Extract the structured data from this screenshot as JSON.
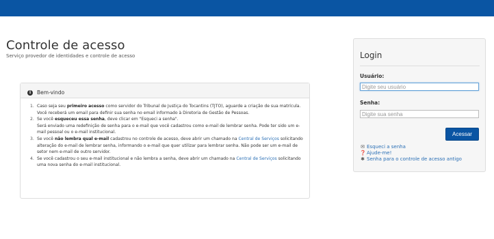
{
  "header": {
    "color": "#0a55a3"
  },
  "page": {
    "title": "Controle de acesso",
    "subtitle": "Serviço provedor de identidades e controle de acesso"
  },
  "welcome": {
    "icon": "info-icon",
    "title": "Bem-vindo",
    "items": [
      {
        "num": "1.",
        "pre": "Caso seja seu ",
        "bold": "primeiro acesso",
        "post": " como servidor do Tribunal de Justiça do Tocantins (TJTO), aguarde a criação de sua matrícula. Você receberá um email para definir sua senha no email informado à Diretoria de Gestão de Pessoas."
      },
      {
        "num": "2.",
        "pre": "Se você ",
        "bold": "esqueceu essa senha",
        "post": ", deve clicar em \"Esqueci a senha\".",
        "extra": "Será enviado uma redefinição de senha para o e-mail que você cadastrou como e-mail de lembrar senha. Pode ter sido um e-mail pessoal ou o e-mail institucional."
      },
      {
        "num": "3.",
        "pre": "Se você ",
        "bold": "não lembra qual e-mail",
        "mid": " cadastrou no controle de acesso, deve abrir um chamado na ",
        "link": "Central de Serviços",
        "post": " solicitando alteração do e-mail de lembrar senha, informando o e-mail que quer utilizar para lembrar senha. Não pode ser um e-mail de setor nem e-mail de outro servidor."
      },
      {
        "num": "4.",
        "pre": "Se você cadastrou o seu e-mail institucional e não lembra a senha, deve abrir um chamado na ",
        "link": "Central de Serviços",
        "post": " solicitando uma nova senha do e-mail institucional."
      }
    ]
  },
  "login": {
    "title": "Login",
    "username_label": "Usuário:",
    "username_placeholder": "Digite seu usuário",
    "password_label": "Senha:",
    "password_placeholder": "Digite sua senha",
    "submit_label": "Acessar",
    "links": [
      {
        "icon": "envelope-icon",
        "label": "Esqueci a senha"
      },
      {
        "icon": "question-icon",
        "label": "Ajude-me!"
      },
      {
        "icon": "asterisk-icon",
        "label": "Senha para o controle de acesso antigo"
      }
    ]
  }
}
